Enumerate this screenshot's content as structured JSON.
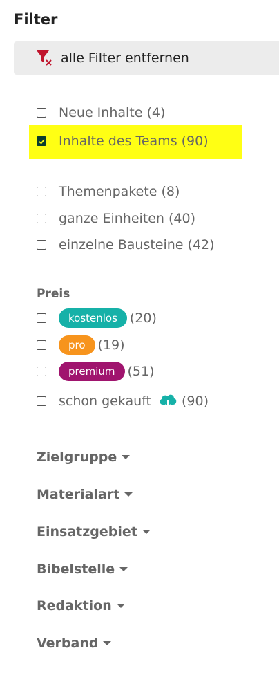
{
  "title": "Filter",
  "clear_filters": {
    "label": "alle Filter entfernen",
    "icon": "filter-remove-icon",
    "icon_color": "#c0152d"
  },
  "content_filters": [
    {
      "label": "Neue Inhalte (4)",
      "checked": false
    },
    {
      "label": "Inhalte des Teams (90)",
      "checked": true,
      "highlight": "#ffff14"
    }
  ],
  "type_filters": [
    {
      "label": "Themenpakete (8)",
      "checked": false
    },
    {
      "label": "ganze Einheiten (40)",
      "checked": false
    },
    {
      "label": "einzelne Bausteine (42)",
      "checked": false
    }
  ],
  "price": {
    "heading": "Preis",
    "items": [
      {
        "badge": "kostenlos",
        "count": "(20)",
        "color": "#16b1a8",
        "checked": false
      },
      {
        "badge": "pro",
        "count": "(19)",
        "color": "#f7941d",
        "checked": false
      },
      {
        "badge": "premium",
        "count": "(51)",
        "color": "#a0146e",
        "checked": false
      },
      {
        "label": "schon gekauft",
        "icon": "cloud-download-icon",
        "count": "(90)",
        "icon_color": "#16b1a8",
        "checked": false
      }
    ]
  },
  "dropdowns": [
    "Zielgruppe",
    "Materialart",
    "Einsatzgebiet",
    "Bibelstelle",
    "Redaktion",
    "Verband"
  ]
}
